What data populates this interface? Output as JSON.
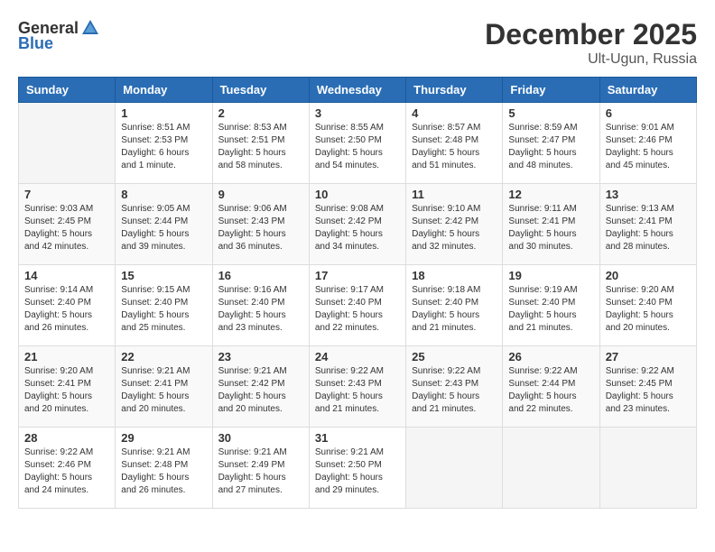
{
  "header": {
    "logo_general": "General",
    "logo_blue": "Blue",
    "month_year": "December 2025",
    "location": "Ult-Ugun, Russia"
  },
  "columns": [
    "Sunday",
    "Monday",
    "Tuesday",
    "Wednesday",
    "Thursday",
    "Friday",
    "Saturday"
  ],
  "weeks": [
    [
      {
        "day": "",
        "info": ""
      },
      {
        "day": "1",
        "info": "Sunrise: 8:51 AM\nSunset: 2:53 PM\nDaylight: 6 hours\nand 1 minute."
      },
      {
        "day": "2",
        "info": "Sunrise: 8:53 AM\nSunset: 2:51 PM\nDaylight: 5 hours\nand 58 minutes."
      },
      {
        "day": "3",
        "info": "Sunrise: 8:55 AM\nSunset: 2:50 PM\nDaylight: 5 hours\nand 54 minutes."
      },
      {
        "day": "4",
        "info": "Sunrise: 8:57 AM\nSunset: 2:48 PM\nDaylight: 5 hours\nand 51 minutes."
      },
      {
        "day": "5",
        "info": "Sunrise: 8:59 AM\nSunset: 2:47 PM\nDaylight: 5 hours\nand 48 minutes."
      },
      {
        "day": "6",
        "info": "Sunrise: 9:01 AM\nSunset: 2:46 PM\nDaylight: 5 hours\nand 45 minutes."
      }
    ],
    [
      {
        "day": "7",
        "info": "Sunrise: 9:03 AM\nSunset: 2:45 PM\nDaylight: 5 hours\nand 42 minutes."
      },
      {
        "day": "8",
        "info": "Sunrise: 9:05 AM\nSunset: 2:44 PM\nDaylight: 5 hours\nand 39 minutes."
      },
      {
        "day": "9",
        "info": "Sunrise: 9:06 AM\nSunset: 2:43 PM\nDaylight: 5 hours\nand 36 minutes."
      },
      {
        "day": "10",
        "info": "Sunrise: 9:08 AM\nSunset: 2:42 PM\nDaylight: 5 hours\nand 34 minutes."
      },
      {
        "day": "11",
        "info": "Sunrise: 9:10 AM\nSunset: 2:42 PM\nDaylight: 5 hours\nand 32 minutes."
      },
      {
        "day": "12",
        "info": "Sunrise: 9:11 AM\nSunset: 2:41 PM\nDaylight: 5 hours\nand 30 minutes."
      },
      {
        "day": "13",
        "info": "Sunrise: 9:13 AM\nSunset: 2:41 PM\nDaylight: 5 hours\nand 28 minutes."
      }
    ],
    [
      {
        "day": "14",
        "info": "Sunrise: 9:14 AM\nSunset: 2:40 PM\nDaylight: 5 hours\nand 26 minutes."
      },
      {
        "day": "15",
        "info": "Sunrise: 9:15 AM\nSunset: 2:40 PM\nDaylight: 5 hours\nand 25 minutes."
      },
      {
        "day": "16",
        "info": "Sunrise: 9:16 AM\nSunset: 2:40 PM\nDaylight: 5 hours\nand 23 minutes."
      },
      {
        "day": "17",
        "info": "Sunrise: 9:17 AM\nSunset: 2:40 PM\nDaylight: 5 hours\nand 22 minutes."
      },
      {
        "day": "18",
        "info": "Sunrise: 9:18 AM\nSunset: 2:40 PM\nDaylight: 5 hours\nand 21 minutes."
      },
      {
        "day": "19",
        "info": "Sunrise: 9:19 AM\nSunset: 2:40 PM\nDaylight: 5 hours\nand 21 minutes."
      },
      {
        "day": "20",
        "info": "Sunrise: 9:20 AM\nSunset: 2:40 PM\nDaylight: 5 hours\nand 20 minutes."
      }
    ],
    [
      {
        "day": "21",
        "info": "Sunrise: 9:20 AM\nSunset: 2:41 PM\nDaylight: 5 hours\nand 20 minutes."
      },
      {
        "day": "22",
        "info": "Sunrise: 9:21 AM\nSunset: 2:41 PM\nDaylight: 5 hours\nand 20 minutes."
      },
      {
        "day": "23",
        "info": "Sunrise: 9:21 AM\nSunset: 2:42 PM\nDaylight: 5 hours\nand 20 minutes."
      },
      {
        "day": "24",
        "info": "Sunrise: 9:22 AM\nSunset: 2:43 PM\nDaylight: 5 hours\nand 21 minutes."
      },
      {
        "day": "25",
        "info": "Sunrise: 9:22 AM\nSunset: 2:43 PM\nDaylight: 5 hours\nand 21 minutes."
      },
      {
        "day": "26",
        "info": "Sunrise: 9:22 AM\nSunset: 2:44 PM\nDaylight: 5 hours\nand 22 minutes."
      },
      {
        "day": "27",
        "info": "Sunrise: 9:22 AM\nSunset: 2:45 PM\nDaylight: 5 hours\nand 23 minutes."
      }
    ],
    [
      {
        "day": "28",
        "info": "Sunrise: 9:22 AM\nSunset: 2:46 PM\nDaylight: 5 hours\nand 24 minutes."
      },
      {
        "day": "29",
        "info": "Sunrise: 9:21 AM\nSunset: 2:48 PM\nDaylight: 5 hours\nand 26 minutes."
      },
      {
        "day": "30",
        "info": "Sunrise: 9:21 AM\nSunset: 2:49 PM\nDaylight: 5 hours\nand 27 minutes."
      },
      {
        "day": "31",
        "info": "Sunrise: 9:21 AM\nSunset: 2:50 PM\nDaylight: 5 hours\nand 29 minutes."
      },
      {
        "day": "",
        "info": ""
      },
      {
        "day": "",
        "info": ""
      },
      {
        "day": "",
        "info": ""
      }
    ]
  ]
}
